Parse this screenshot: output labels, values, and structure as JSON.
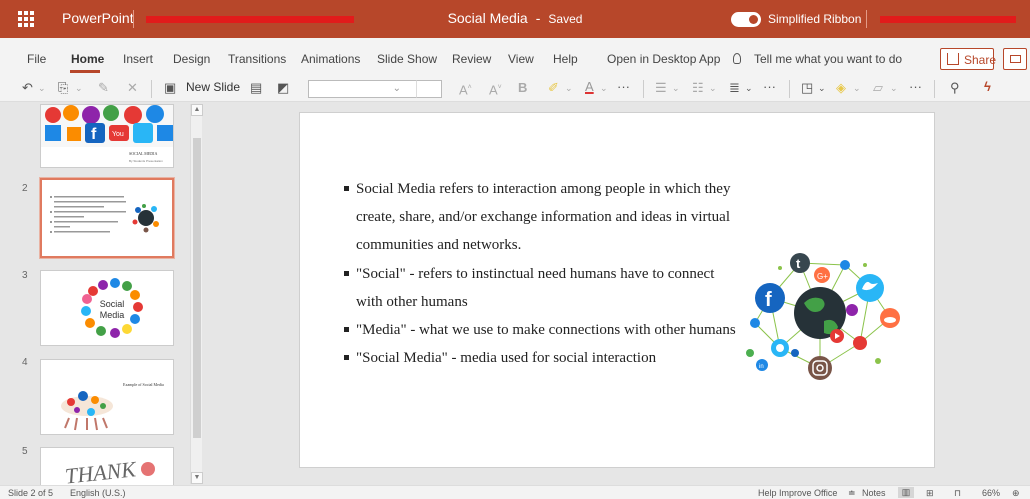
{
  "titlebar": {
    "app_name": "PowerPoint",
    "doc_title": "Social Media",
    "separator": "-",
    "save_state": "Saved",
    "ribbon_toggle_label": "Simplified Ribbon"
  },
  "menu": {
    "items": [
      "File",
      "Home",
      "Insert",
      "Design",
      "Transitions",
      "Animations",
      "Slide Show",
      "Review",
      "View",
      "Help",
      "Open in Desktop App"
    ],
    "active": "Home",
    "tell_me": "Tell me what you want to do",
    "share_label": "Share"
  },
  "ribbon": {
    "new_slide_label": "New Slide"
  },
  "thumbnails": {
    "slide1": {
      "title": "SOCIAL MEDIA",
      "subtitle": "By Students Presentation"
    },
    "slide3": {
      "word1": "Social",
      "word2": "Media"
    },
    "slide4": {
      "title": "Example of Social Media"
    },
    "slide5": {
      "text": "THANK"
    },
    "numbers": [
      "2",
      "3",
      "4",
      "5"
    ]
  },
  "slide": {
    "bullets": [
      "Social Media refers to interaction among people in which they create, share, and/or exchange information and ideas in virtual communities and networks.",
      "\"Social\" - refers to instinctual need humans have to connect with other humans",
      "\"Media\" - what we use to make connections with other humans",
      "\"Social Media\" - media used for social interaction"
    ]
  },
  "statusbar": {
    "slide_position": "Slide 2 of 5",
    "language": "English (U.S.)",
    "help_improve": "Help Improve Office",
    "notes_label": "Notes",
    "zoom": "66%"
  },
  "colors": {
    "brand": "#b7472a",
    "selection": "#e07a5f",
    "redaction": "#e21b1b"
  }
}
